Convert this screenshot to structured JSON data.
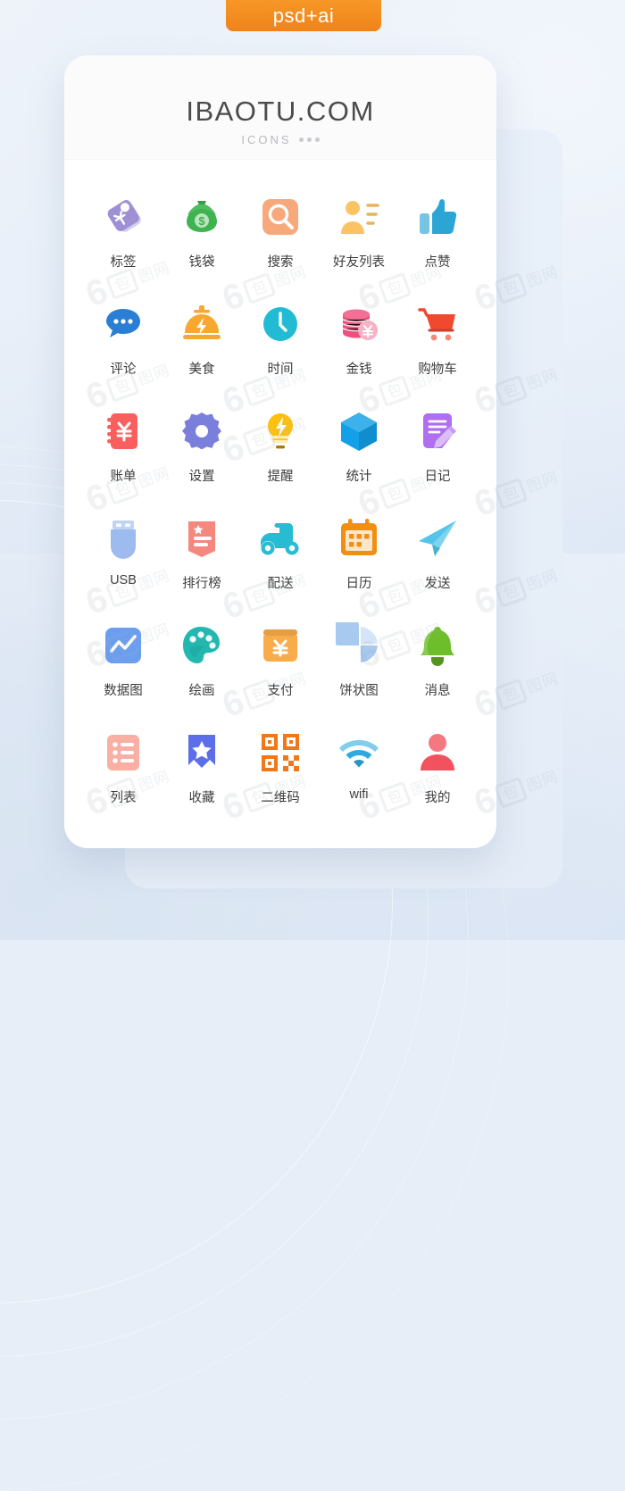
{
  "badge": {
    "label": "psd+ai"
  },
  "header": {
    "brand": "IBAOTU.COM",
    "subtitle": "ICONS",
    "dots": 3
  },
  "watermark": {
    "text": "包图网",
    "mark": "6"
  },
  "colors": {
    "page_bg": "#e8eef7",
    "card_bg": "#ffffff",
    "card_head_bg": "#fbfbfc",
    "badge_orange": "#f0831a",
    "label_text": "#3c3c3c",
    "brand_text": "#4b4b4b",
    "subtitle_text": "#b7b9bc"
  },
  "grid": {
    "columns": 5,
    "rows": 6,
    "icons": [
      {
        "label": "标签",
        "icon": "tag-icon",
        "color": "#9f8fd4"
      },
      {
        "label": "钱袋",
        "icon": "money-bag-icon",
        "color": "#3eb34f"
      },
      {
        "label": "搜索",
        "icon": "search-icon",
        "color": "#f7a97c"
      },
      {
        "label": "好友列表",
        "icon": "friend-list-icon",
        "color": "#fcc364"
      },
      {
        "label": "点赞",
        "icon": "thumbs-up-icon",
        "color": "#2ba6d4"
      },
      {
        "label": "评论",
        "icon": "comment-icon",
        "color": "#2a7fd4"
      },
      {
        "label": "美食",
        "icon": "food-bell-icon",
        "color": "#f8a831"
      },
      {
        "label": "时间",
        "icon": "clock-icon",
        "color": "#21bcd4"
      },
      {
        "label": "金钱",
        "icon": "coins-icon",
        "color": "#ef4f7e"
      },
      {
        "label": "购物车",
        "icon": "shopping-cart-icon",
        "color": "#f0492f"
      },
      {
        "label": "账单",
        "icon": "bill-icon",
        "color": "#fa5f5f"
      },
      {
        "label": "设置",
        "icon": "settings-gear-icon",
        "color": "#7b7fdc"
      },
      {
        "label": "提醒",
        "icon": "lightbulb-icon",
        "color": "#fcc110"
      },
      {
        "label": "统计",
        "icon": "cube-icon",
        "color": "#12a0e8"
      },
      {
        "label": "日记",
        "icon": "diary-pencil-icon",
        "color": "#b06ef0"
      },
      {
        "label": "USB",
        "icon": "usb-icon",
        "color": "#9dbbee"
      },
      {
        "label": "排行榜",
        "icon": "ranking-icon",
        "color": "#f4877e"
      },
      {
        "label": "配送",
        "icon": "scooter-icon",
        "color": "#26bcd4"
      },
      {
        "label": "日历",
        "icon": "calendar-icon",
        "color": "#f08f12"
      },
      {
        "label": "发送",
        "icon": "send-plane-icon",
        "color": "#53c4ea"
      },
      {
        "label": "数据图",
        "icon": "line-chart-icon",
        "color": "#6c9ef0"
      },
      {
        "label": "绘画",
        "icon": "palette-icon",
        "color": "#22b8b0"
      },
      {
        "label": "支付",
        "icon": "payment-icon",
        "color": "#f9ac4a"
      },
      {
        "label": "饼状图",
        "icon": "pie-chart-icon",
        "color": "#a8caf0"
      },
      {
        "label": "消息",
        "icon": "bell-icon",
        "color": "#6ebe2c"
      },
      {
        "label": "列表",
        "icon": "list-icon",
        "color": "#f79080"
      },
      {
        "label": "收藏",
        "icon": "bookmark-star-icon",
        "color": "#5c6ee8"
      },
      {
        "label": "二维码",
        "icon": "qr-code-icon",
        "color": "#f07818"
      },
      {
        "label": "wifi",
        "icon": "wifi-icon",
        "color": "#2eaae0"
      },
      {
        "label": "我的",
        "icon": "user-profile-icon",
        "color": "#f2525e"
      }
    ]
  }
}
